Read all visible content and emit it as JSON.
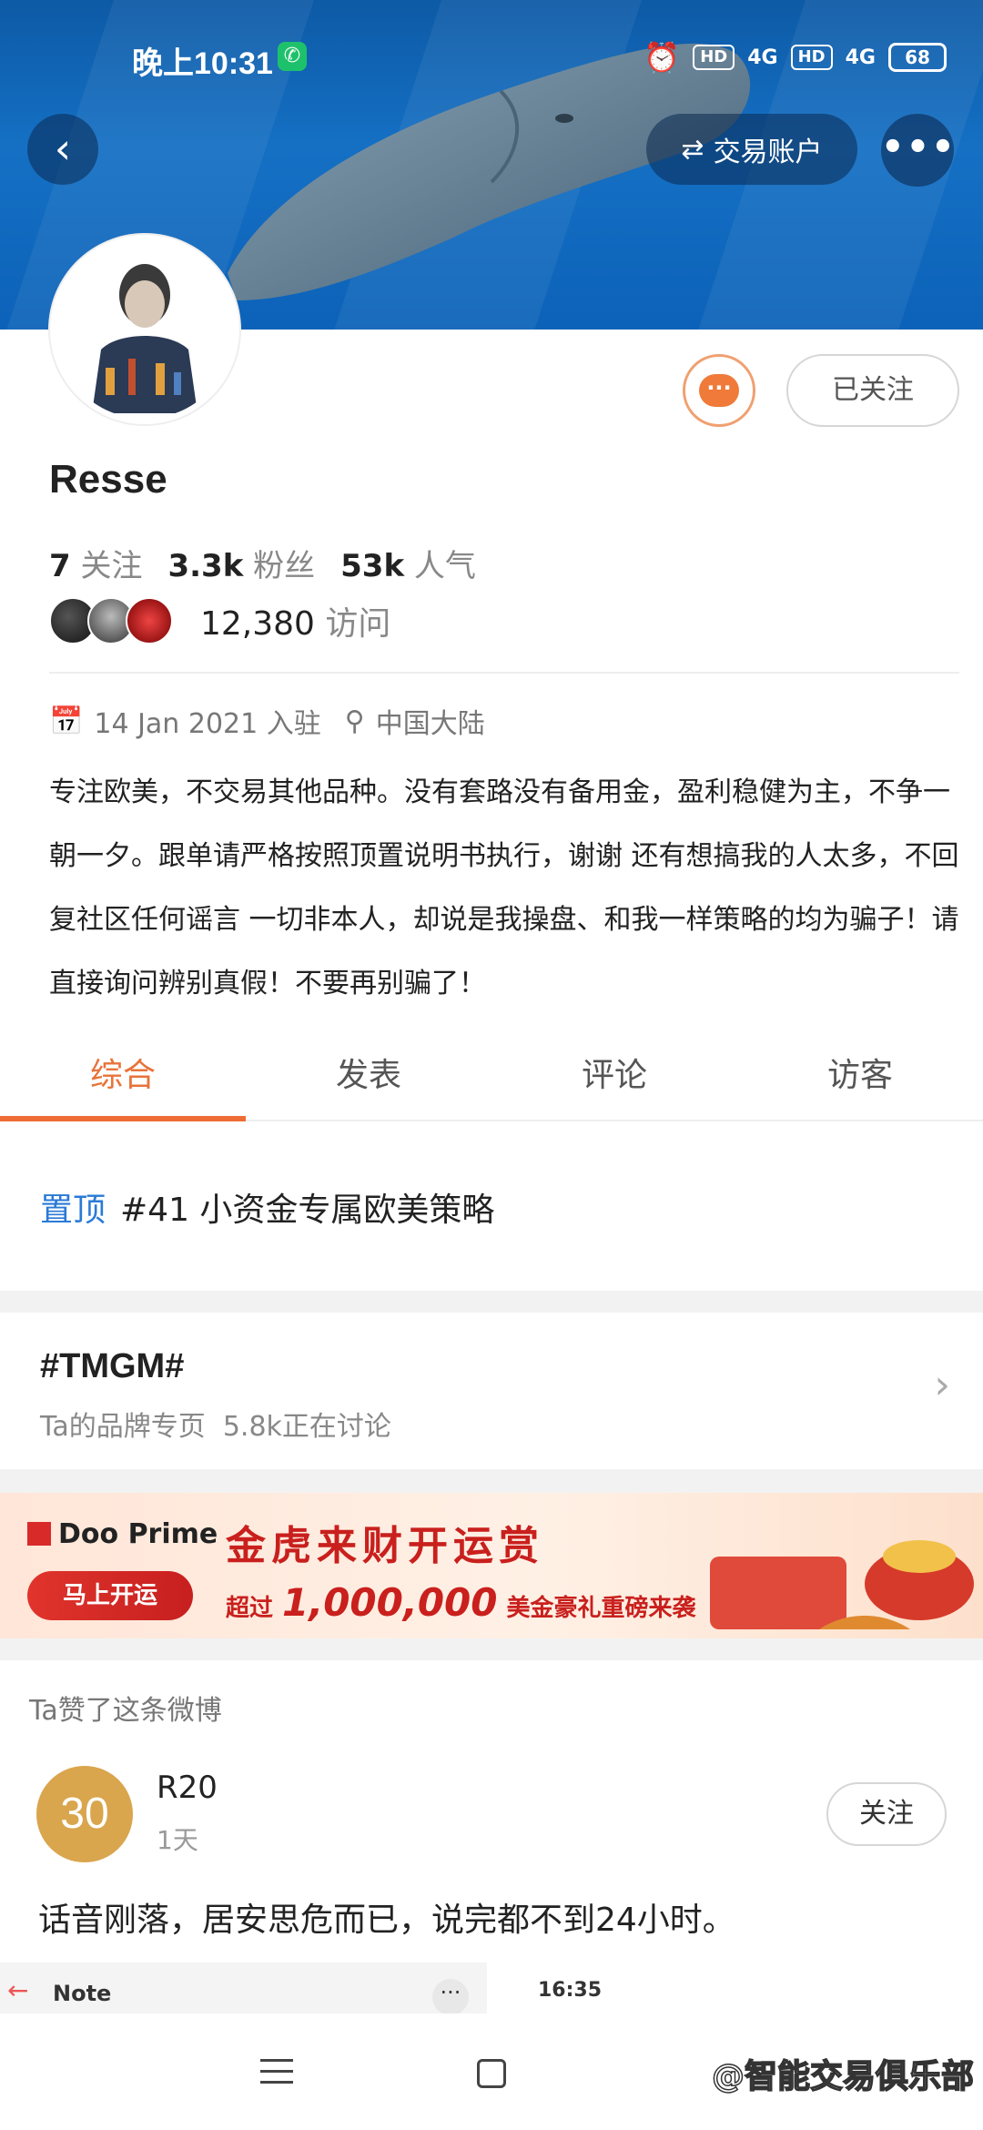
{
  "status_bar": {
    "time": "晚上10:31",
    "net1": "4G",
    "net2": "4G",
    "battery": "68",
    "hd1": "HD",
    "hd2": "HD"
  },
  "header": {
    "back_icon": "chevron-left-icon",
    "trade_account_label": "交易账户",
    "more_icon": "more-icon"
  },
  "profile": {
    "follow_button": "已关注",
    "name": "Resse",
    "following_count": "7",
    "following_label": "关注",
    "fans_count": "3.3k",
    "fans_label": "粉丝",
    "popularity_count": "53k",
    "popularity_label": "人气",
    "visits_count": "12,380",
    "visits_label": "访问",
    "joined_date": "14 Jan 2021 入驻",
    "location": "中国大陆",
    "bio": "专注欧美，不交易其他品种。没有套路没有备用金，盈利稳健为主，不争一朝一夕。跟单请严格按照顶置说明书执行，谢谢 还有想搞我的人太多，不回复社区任何谣言 一切非本人，却说是我操盘、和我一样策略的均为骗子！请直接询问辨别真假！不要再别骗了！"
  },
  "tabs": [
    {
      "label": "综合",
      "active": true
    },
    {
      "label": "发表",
      "active": false
    },
    {
      "label": "评论",
      "active": false
    },
    {
      "label": "访客",
      "active": false
    }
  ],
  "pinned": {
    "tag": "置顶",
    "title": "#41 小资金专属欧美策略"
  },
  "topic": {
    "title": "#TMGM#",
    "subtitle": "Ta的品牌专页",
    "discussing": "5.8k正在讨论"
  },
  "ad": {
    "brand": "Doo Prime",
    "button": "马上开运",
    "headline": "金虎来财开运赏",
    "line_prefix": "超过",
    "line_number": "1,000,000",
    "line_suffix": "美金豪礼重磅来袭"
  },
  "liked_post": {
    "notice": "Ta赞了这条微博",
    "avatar_text": "30",
    "author": "R20",
    "time": "1天",
    "follow_button": "关注",
    "text": "话音刚落，居安思危而已，说完都不到24小时。",
    "thumb1_title": "Note",
    "thumb2_time": "16:35"
  },
  "navbar": {
    "watermark": "@智能交易俱乐部"
  },
  "colors": {
    "accent": "#ef6c35",
    "link": "#2a7ad6",
    "banner": "#1570c4"
  }
}
